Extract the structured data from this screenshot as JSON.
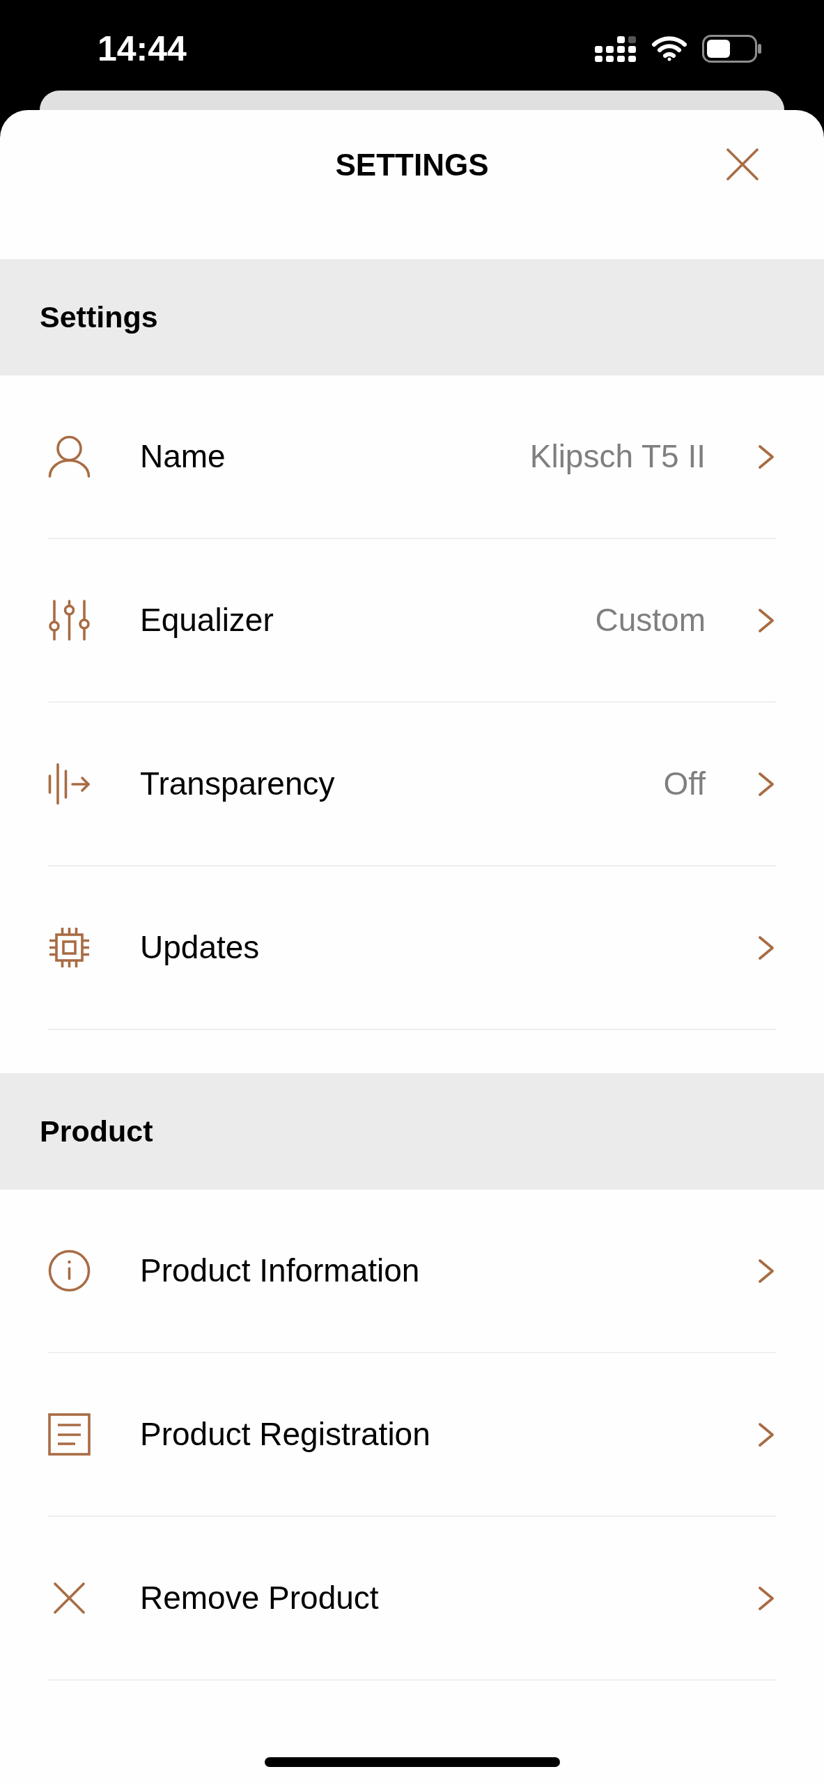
{
  "status_bar": {
    "time": "14:44"
  },
  "header": {
    "title": "SETTINGS"
  },
  "sections": [
    {
      "title": "Settings",
      "items": [
        {
          "label": "Name",
          "value": "Klipsch T5 II"
        },
        {
          "label": "Equalizer",
          "value": "Custom"
        },
        {
          "label": "Transparency",
          "value": "Off"
        },
        {
          "label": "Updates"
        }
      ]
    },
    {
      "title": "Product",
      "items": [
        {
          "label": "Product Information"
        },
        {
          "label": "Product Registration"
        },
        {
          "label": "Remove Product"
        }
      ]
    }
  ]
}
